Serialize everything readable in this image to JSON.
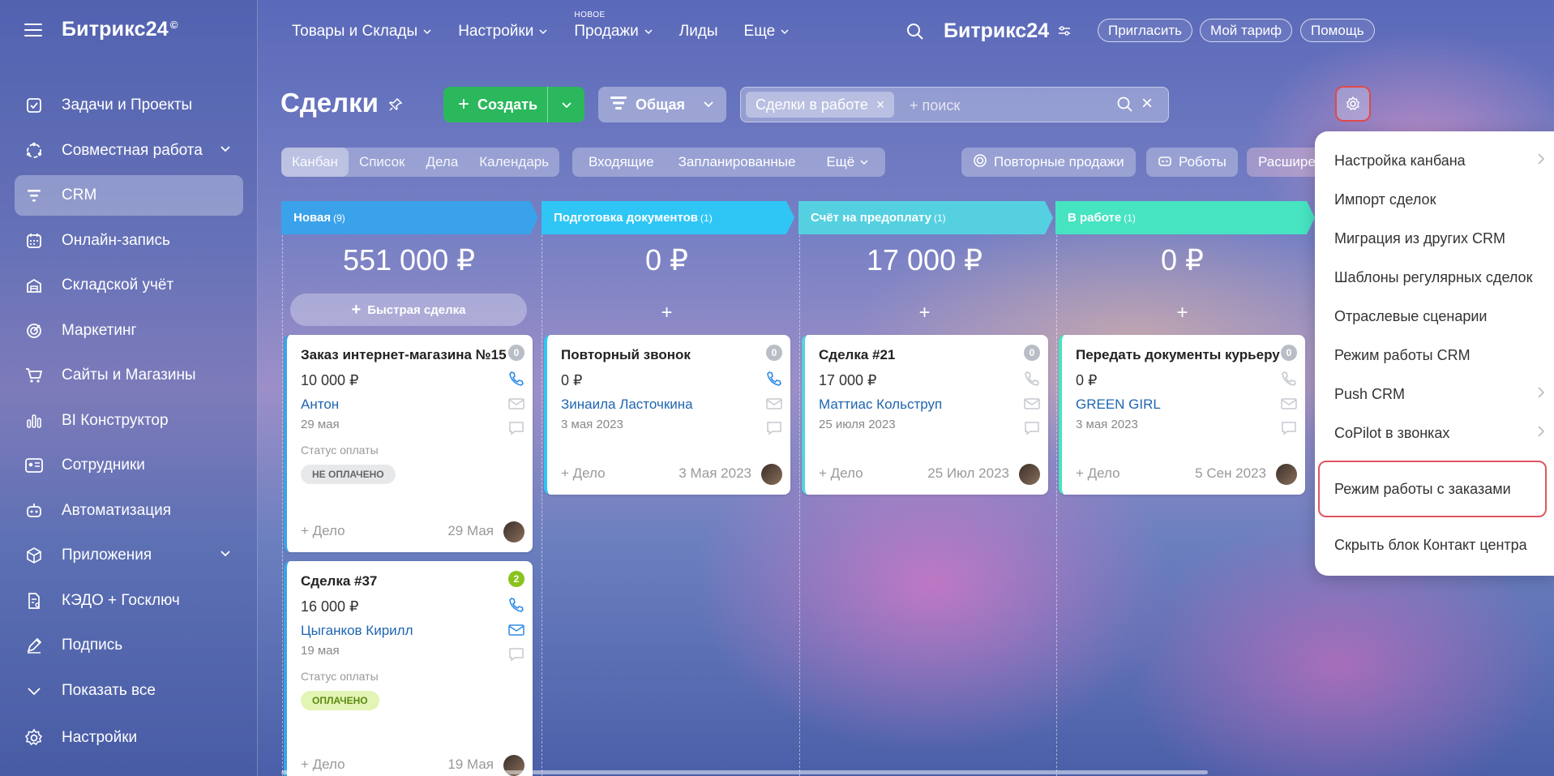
{
  "sidebar": {
    "brand": "Битрикс24",
    "brand_mark": "©",
    "items": [
      {
        "label": "Задачи и Проекты",
        "icon": "checkbox-icon"
      },
      {
        "label": "Совместная работа",
        "icon": "collab-icon"
      },
      {
        "label": "CRM",
        "icon": "crm-filter-icon"
      },
      {
        "label": "Онлайн-запись",
        "icon": "calendar-icon"
      },
      {
        "label": "Складской учёт",
        "icon": "warehouse-icon"
      },
      {
        "label": "Маркетинг",
        "icon": "target-icon"
      },
      {
        "label": "Сайты и Магазины",
        "icon": "cart-icon"
      },
      {
        "label": "BI Конструктор",
        "icon": "bar-chart-icon"
      },
      {
        "label": "Сотрудники",
        "icon": "id-card-icon"
      },
      {
        "label": "Автоматизация",
        "icon": "robot-icon"
      },
      {
        "label": "Приложения",
        "icon": "cube-icon"
      },
      {
        "label": "КЭДО + Госключ",
        "icon": "document-key-icon"
      },
      {
        "label": "Подпись",
        "icon": "pen-icon"
      },
      {
        "label": "Показать все",
        "icon": "chevron-down-icon"
      }
    ],
    "settings_label": "Настройки"
  },
  "topnav": {
    "items": [
      "Товары и Склады",
      "Настройки",
      "Продажи",
      "Лиды",
      "Еще"
    ],
    "new_label": "НОВОЕ",
    "brand": "Битрикс24",
    "invite": "Пригласить",
    "tariff": "Мой тариф",
    "help": "Помощь"
  },
  "toolbar": {
    "title": "Сделки",
    "create": "Создать",
    "filter": "Общая",
    "search_tag": "Сделки в работе",
    "search_placeholder": "+ поиск"
  },
  "views": {
    "tabs": [
      "Канбан",
      "Список",
      "Дела",
      "Календарь"
    ],
    "stage_tabs": [
      "Входящие",
      "Запланированные",
      "Ещё"
    ],
    "repeat_sales": "Повторные продажи",
    "robots": "Роботы",
    "extensions": "Расширения"
  },
  "columns": [
    {
      "name": "Новая",
      "count": "(9)",
      "sum": "551 000 ₽",
      "color": "#3aa2ea"
    },
    {
      "name": "Подготовка документов",
      "count": "(1)",
      "sum": "0 ₽",
      "color": "#2fc6f6"
    },
    {
      "name": "Счёт на предоплату",
      "count": "(1)",
      "sum": "17 000 ₽",
      "color": "#55d0e0"
    },
    {
      "name": "В работе",
      "count": "(1)",
      "sum": "0 ₽",
      "color": "#47e4c2"
    }
  ],
  "quick_deal": "Быстрая сделка",
  "cards": [
    {
      "title": "Заказ интернет-магазина №15",
      "sum": "10 000 ₽",
      "contact": "Антон",
      "date": "29 мая",
      "badge": "0",
      "pay_label": "Статус оплаты",
      "pay_status": "НЕ ОПЛАЧЕНО",
      "add": "+ Дело",
      "due": "29 Мая"
    },
    {
      "title": "Сделка #37",
      "sum": "16 000 ₽",
      "contact": "Цыганков Кирилл",
      "date": "19 мая",
      "badge": "2",
      "pay_label": "Статус оплаты",
      "pay_status": "ОПЛАЧЕНО",
      "add": "+ Дело",
      "due": "19 Мая"
    },
    {
      "title": "Повторный звонок",
      "sum": "0 ₽",
      "contact": "Зинаила Ласточкина",
      "date": "3 мая 2023",
      "badge": "0",
      "add": "+ Дело",
      "due": "3 Мая 2023"
    },
    {
      "title": "Сделка #21",
      "sum": "17 000 ₽",
      "contact": "Маттиас Кольструп",
      "date": "25 июля 2023",
      "badge": "0",
      "add": "+ Дело",
      "due": "25 Июл 2023"
    },
    {
      "title": "Передать документы курьеру",
      "sum": "0 ₽",
      "contact": "GREEN GIRL",
      "date": "3 мая 2023",
      "badge": "0",
      "add": "+ Дело",
      "due": "5 Сен 2023"
    }
  ],
  "menu": {
    "items": [
      "Настройка канбана",
      "Импорт сделок",
      "Миграция из других CRM",
      "Шаблоны регулярных сделок",
      "Отраслевые сценарии",
      "Режим работы CRM",
      "Push CRM",
      "CoPilot в звонках",
      "Режим работы с заказами",
      "Скрыть блок Контакт центра"
    ]
  },
  "colors": {
    "accent_green": "#2bb85c",
    "highlight_red": "#e05560",
    "link_blue": "#2066b0"
  }
}
